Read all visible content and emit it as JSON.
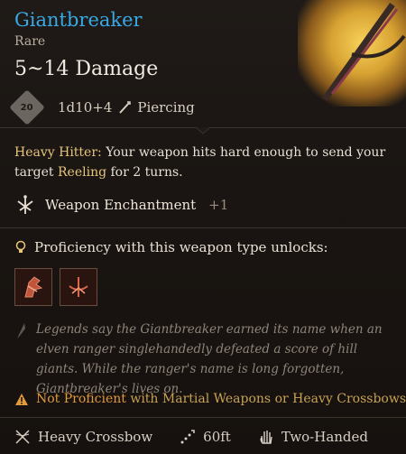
{
  "item": {
    "name": "Giantbreaker",
    "rarity": "Rare",
    "damage": "5~14 Damage",
    "dice_badge": "20",
    "dice": "1d10+4",
    "damage_type": "Piercing"
  },
  "passive": {
    "name": "Heavy Hitter:",
    "text_before": " Your weapon hits hard enough to send your target ",
    "condition": "Reeling",
    "text_after": " for 2 turns."
  },
  "enchantment": {
    "label": "Weapon Enchantment",
    "bonus": "+1"
  },
  "proficiency": {
    "label": "Proficiency with this weapon type unlocks:",
    "unlocks": [
      "weapon-action-icon-1",
      "weapon-action-icon-2"
    ]
  },
  "lore": "Legends say the Giantbreaker earned its name when an elven ranger singlehandedly defeated a score of hill giants. While the ranger's name is long forgotten, Giantbreaker's lives on.",
  "warning": {
    "not": "Not Proficient",
    "rest": " with Martial Weapons or Heavy Crossbows"
  },
  "properties": {
    "weapon_type": "Heavy Crossbow",
    "range": "60ft",
    "handedness": "Two-Handed"
  },
  "colors": {
    "rare_name": "#39a9e6",
    "highlight": "#e7c67c",
    "warning": "#e09a3a"
  }
}
